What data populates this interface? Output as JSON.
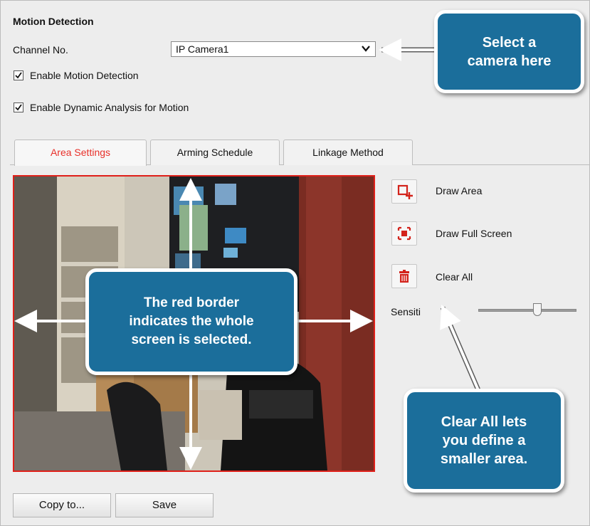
{
  "section": {
    "title": "Motion Detection"
  },
  "channel": {
    "label": "Channel No.",
    "value": "IP Camera1"
  },
  "options": {
    "enable_motion": {
      "label": "Enable Motion Detection",
      "checked": true
    },
    "enable_dynamic": {
      "label": "Enable Dynamic Analysis for Motion",
      "checked": true
    }
  },
  "tabs": [
    {
      "label": "Area Settings",
      "active": true
    },
    {
      "label": "Arming Schedule",
      "active": false
    },
    {
      "label": "Linkage Method",
      "active": false
    }
  ],
  "tools": {
    "draw_area": "Draw Area",
    "draw_full_screen": "Draw Full Screen",
    "clear_all": "Clear All",
    "sensitivity": "Sensiti"
  },
  "sensitivity_level": 0.6,
  "buttons": {
    "copy": "Copy to...",
    "save": "Save"
  },
  "callouts": {
    "camera": {
      "line1": "Select a",
      "line2": "camera here"
    },
    "border": {
      "line1": "The red border",
      "line2": "indicates the whole",
      "line3": "screen is selected."
    },
    "clear": {
      "bold": "Clear All",
      "rest1": " lets",
      "line2": "you define a",
      "line3": "smaller area."
    }
  },
  "colors": {
    "accent_red": "#e0201a",
    "callout_blue": "#1b6e9b"
  },
  "icons": [
    "draw-area-icon",
    "draw-full-screen-icon",
    "trash-icon",
    "chevron-down-icon",
    "checkmark-icon"
  ]
}
